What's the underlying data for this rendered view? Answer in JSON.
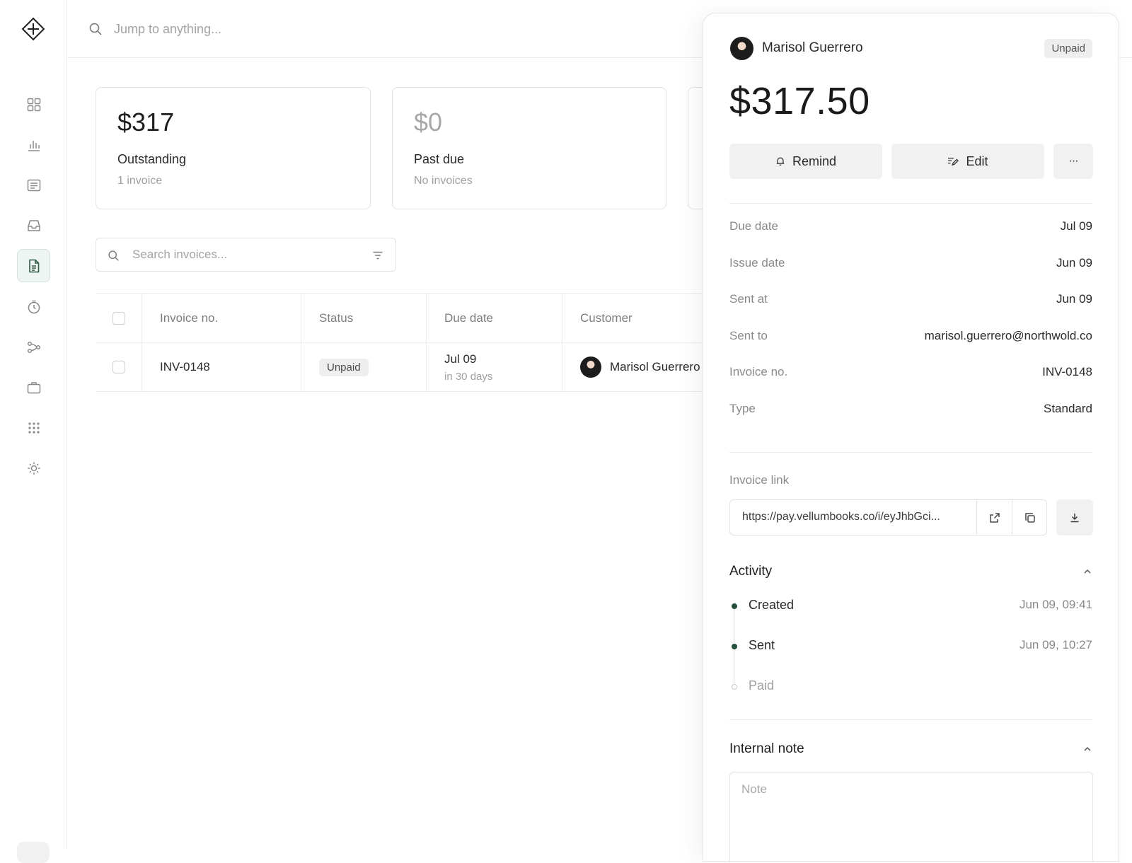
{
  "search": {
    "placeholder": "Jump to anything..."
  },
  "sidebar": {
    "items": [
      {
        "icon": "grid-icon"
      },
      {
        "icon": "bar-chart-icon"
      },
      {
        "icon": "list-icon"
      },
      {
        "icon": "inbox-icon"
      },
      {
        "icon": "document-icon",
        "active": true
      },
      {
        "icon": "timer-icon"
      },
      {
        "icon": "branch-icon"
      },
      {
        "icon": "briefcase-icon"
      },
      {
        "icon": "apps-icon"
      },
      {
        "icon": "sun-icon"
      }
    ]
  },
  "cards": [
    {
      "amount": "$317",
      "label": "Outstanding",
      "sub": "1 invoice"
    },
    {
      "amount": "$0",
      "label": "Past due",
      "sub": "No invoices"
    }
  ],
  "invoice_search": {
    "placeholder": "Search invoices..."
  },
  "table": {
    "headers": {
      "invoice_no": "Invoice no.",
      "status": "Status",
      "due_date": "Due date",
      "customer": "Customer"
    },
    "rows": [
      {
        "invoice_no": "INV-0148",
        "status": "Unpaid",
        "due_date": "Jul 09",
        "due_relative": "in 30 days",
        "customer": "Marisol Guerrero"
      }
    ]
  },
  "panel": {
    "customer_name": "Marisol Guerrero",
    "status": "Unpaid",
    "amount": "$317.50",
    "buttons": {
      "remind": "Remind",
      "edit": "Edit",
      "more": "···"
    },
    "details": {
      "due_date_label": "Due date",
      "due_date": "Jul 09",
      "issue_date_label": "Issue date",
      "issue_date": "Jun 09",
      "sent_at_label": "Sent at",
      "sent_at": "Jun 09",
      "sent_to_label": "Sent to",
      "sent_to": "marisol.guerrero@northwold.co",
      "invoice_no_label": "Invoice no.",
      "invoice_no": "INV-0148",
      "type_label": "Type",
      "type": "Standard"
    },
    "invoice_link_label": "Invoice link",
    "invoice_link": "https://pay.vellumbooks.co/i/eyJhbGci...",
    "activity_title": "Activity",
    "activity": [
      {
        "label": "Created",
        "time": "Jun 09, 09:41",
        "done": true
      },
      {
        "label": "Sent",
        "time": "Jun 09, 10:27",
        "done": true
      },
      {
        "label": "Paid",
        "time": "",
        "done": false
      }
    ],
    "note_title": "Internal note",
    "note_placeholder": "Note"
  },
  "colors": {
    "accent": "#234f3b",
    "active_nav_bg": "#eef4f1"
  }
}
